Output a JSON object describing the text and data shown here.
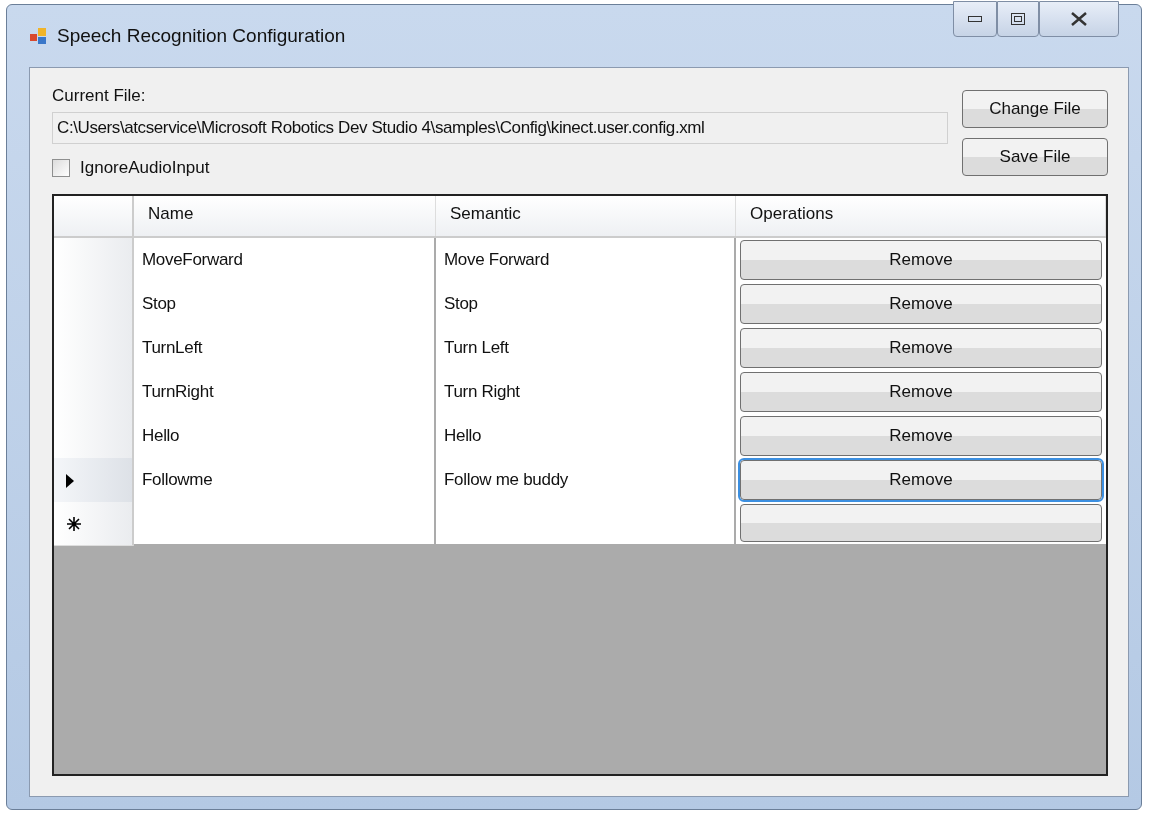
{
  "window": {
    "title": "Speech Recognition Configuration"
  },
  "current_file": {
    "label": "Current File:",
    "value": "C:\\Users\\atcservice\\Microsoft Robotics Dev Studio 4\\samples\\Config\\kinect.user.config.xml"
  },
  "buttons": [
    "Change File",
    "Save File"
  ],
  "ignore_audio_input": {
    "label": "IgnoreAudioInput",
    "checked": false
  },
  "table": {
    "columns": [
      "Name",
      "Semantic",
      "Operations"
    ],
    "rows": [
      {
        "kind": "data",
        "name": "MoveForward",
        "semantic": "Move Forward",
        "button": "Remove",
        "selected": false
      },
      {
        "kind": "data",
        "name": "Stop",
        "semantic": "Stop",
        "button": "Remove",
        "selected": false
      },
      {
        "kind": "data",
        "name": "TurnLeft",
        "semantic": "Turn Left",
        "button": "Remove",
        "selected": false
      },
      {
        "kind": "data",
        "name": "TurnRight",
        "semantic": "Turn Right",
        "button": "Remove",
        "selected": false
      },
      {
        "kind": "data",
        "name": "Hello",
        "semantic": "Hello",
        "button": "Remove",
        "selected": false
      },
      {
        "kind": "data",
        "name": "Followme",
        "semantic": "Follow me buddy",
        "button": "Remove",
        "selected": true
      },
      {
        "kind": "new",
        "selected": false
      }
    ]
  }
}
